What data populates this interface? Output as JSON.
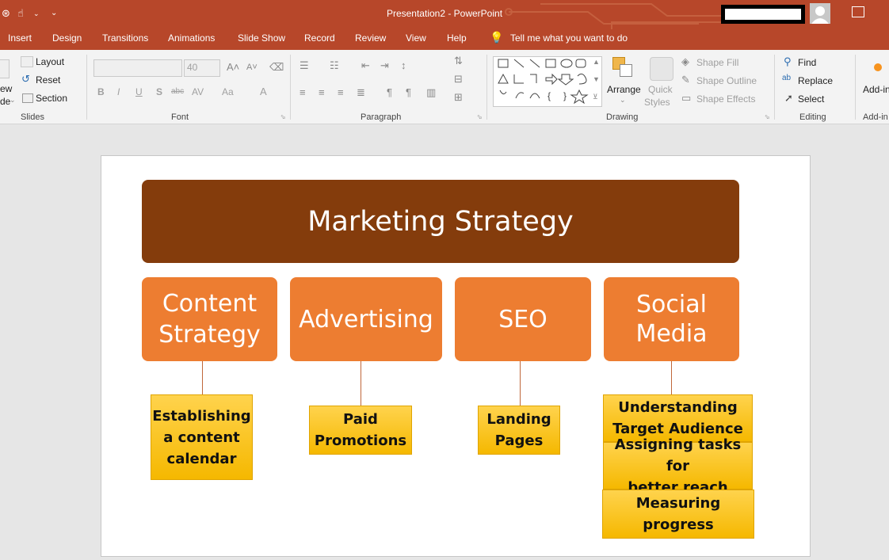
{
  "titlebar": {
    "title": "Presentation2  -  PowerPoint"
  },
  "tabs": [
    "Insert",
    "Design",
    "Transitions",
    "Animations",
    "Slide Show",
    "Record",
    "Review",
    "View",
    "Help"
  ],
  "tell_me": "Tell me what you want to do",
  "ribbon": {
    "slides": {
      "new_slide_partial": "ew",
      "new_slide_partial2": "de",
      "layout": "Layout",
      "reset": "Reset",
      "section": "Section",
      "group": "Slides"
    },
    "font": {
      "font_size": "40",
      "bold": "B",
      "italic": "I",
      "underline": "U",
      "shadow": "S",
      "strike": "abc",
      "spacing": "AV",
      "case": "Aa",
      "color": "A",
      "group": "Font"
    },
    "paragraph": {
      "group": "Paragraph"
    },
    "drawing": {
      "arrange": "Arrange",
      "quick_styles_1": "Quick",
      "quick_styles_2": "Styles",
      "shape_fill": "Shape Fill",
      "shape_outline": "Shape Outline",
      "shape_effects": "Shape Effects",
      "group": "Drawing"
    },
    "editing": {
      "find": "Find",
      "replace": "Replace",
      "select": "Select",
      "group": "Editing"
    },
    "addins": {
      "label": "Add-ins",
      "group": "Add-in"
    }
  },
  "slide": {
    "title": "Marketing Strategy",
    "categories": [
      {
        "line1": "Content",
        "line2": "Strategy"
      },
      {
        "line1": "Advertising",
        "line2": ""
      },
      {
        "line1": "SEO",
        "line2": ""
      },
      {
        "line1": "Social",
        "line2": "Media"
      }
    ],
    "subitems": {
      "content": {
        "l1": "Establishing",
        "l2": "a content",
        "l3": "calendar"
      },
      "advertising": {
        "l1": "Paid",
        "l2": "Promotions"
      },
      "seo": {
        "l1": "Landing",
        "l2": "Pages"
      },
      "social": [
        {
          "l1": "Understanding",
          "l2": "Target Audience"
        },
        {
          "l1": "Assigning tasks for",
          "l2": "better reach"
        },
        {
          "l1": "Measuring",
          "l2": "progress"
        }
      ]
    }
  },
  "colors": {
    "accent": "#b7472a",
    "header": "#843c0c",
    "node": "#ed7d31",
    "leaf": "#ffc000"
  }
}
